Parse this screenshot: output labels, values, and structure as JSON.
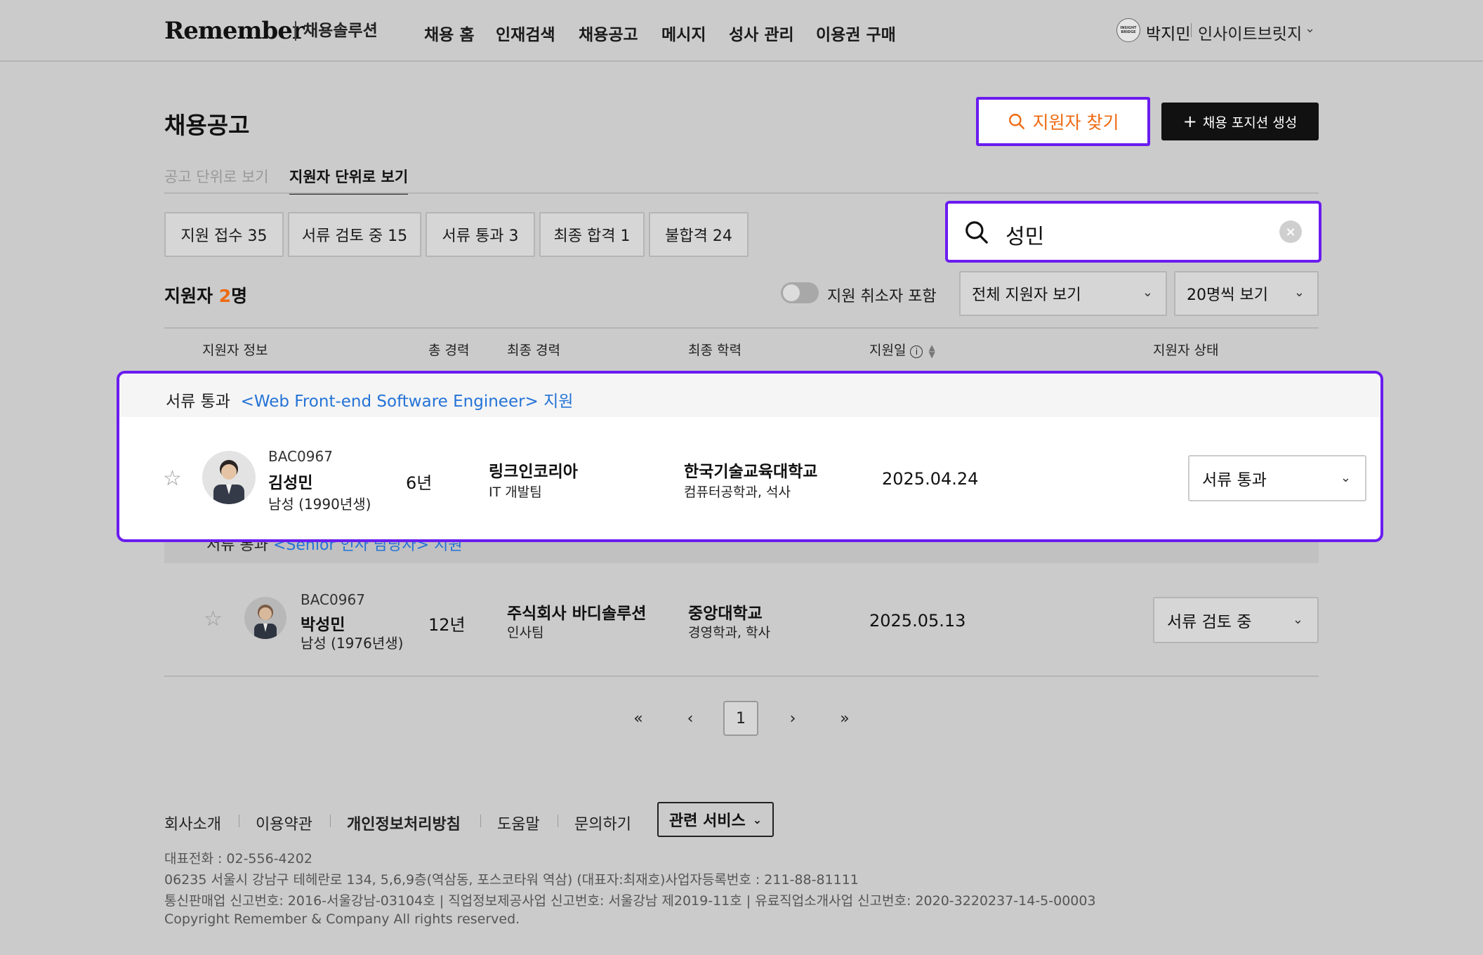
{
  "header": {
    "logo": "Remember",
    "logo_sub": "채용솔루션",
    "nav": [
      "채용 홈",
      "인재검색",
      "채용공고",
      "메시지",
      "성사 관리",
      "이용권 구매"
    ],
    "user_avatar_text": "INSIGHT BRIDGE",
    "user_name": "박지민",
    "user_company": "인사이트브릿지"
  },
  "page": {
    "title": "채용공고",
    "find_button": "지원자 찾기",
    "create_button": "채용 포지션 생성",
    "tabs": [
      "공고 단위로 보기",
      "지원자 단위로 보기"
    ]
  },
  "filters": {
    "chips": [
      "지원 접수 35",
      "서류 검토 중 15",
      "서류 통과 3",
      "최종 합격 1",
      "불합격 24"
    ],
    "search_value": "성민"
  },
  "list": {
    "count_prefix": "지원자 ",
    "count_number": "2",
    "count_suffix": "명",
    "toggle_label": "지원 취소자 포함",
    "view_select": "전체 지원자 보기",
    "page_size_select": "20명씩 보기",
    "headers": [
      "지원자 정보",
      "총 경력",
      "최종 경력",
      "최종 학력",
      "지원일",
      "지원자 상태"
    ]
  },
  "rows": [
    {
      "group_status": "서류 통과",
      "group_position": "<Web Front-end Software Engineer> 지원",
      "code": "BAC0967",
      "name": "김성민",
      "gender": "남성 (1990년생)",
      "career_total": "6년",
      "company": "링크인코리아",
      "team": "IT 개발팀",
      "school": "한국기술교육대학교",
      "major": "컴퓨터공학과, 석사",
      "applied": "2025.04.24",
      "status": "서류 통과"
    },
    {
      "group_status": "서류 통과",
      "group_position": "<Senior 인사 담당자> 지원",
      "code": "BAC0967",
      "name": "박성민",
      "gender": "남성 (1976년생)",
      "career_total": "12년",
      "company": "주식회사 바디솔루션",
      "team": "인사팀",
      "school": "중앙대학교",
      "major": "경영학과, 학사",
      "applied": "2025.05.13",
      "status": "서류 검토 중"
    }
  ],
  "pagination": {
    "current": "1"
  },
  "footer": {
    "links": [
      "회사소개",
      "이용약관",
      "개인정보처리방침",
      "도움말",
      "문의하기"
    ],
    "related": "관련 서비스",
    "info": [
      "대표전화 : 02-556-4202",
      "06235 서울시 강남구 테헤란로 134, 5,6,9층(역삼동, 포스코타워 역삼) (대표자:최재호)사업자등록번호 : 211-88-81111",
      "통신판매업 신고번호: 2016-서울강남-03104호 | 직업정보제공사업 신고번호: 서울강남 제2019-11호 | 유료직업소개사업 신고번호: 2020-3220237-14-5-00003",
      "Copyright Remember & Company All rights reserved."
    ]
  },
  "colors": {
    "accent_orange": "#ee6a12",
    "highlight_purple": "#6a1cf0",
    "link_blue": "#2473d6"
  }
}
